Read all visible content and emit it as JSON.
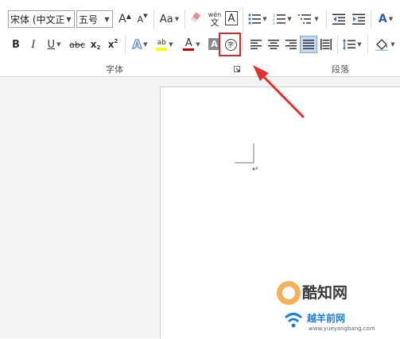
{
  "font": {
    "name": "宋体 (中文正",
    "size": "五号"
  },
  "buttons": {
    "grow_font": "A",
    "shrink_font": "A",
    "change_case": "Aa",
    "phonetic_top": "wén",
    "phonetic_bottom": "文",
    "char_border": "A",
    "bold": "B",
    "italic": "I",
    "underline": "U",
    "strikethrough": "abc",
    "subscript_base": "x",
    "subscript_sub": "2",
    "superscript_base": "x",
    "superscript_sup": "2",
    "text_effects": "A",
    "highlight": "ab",
    "font_color": "A",
    "char_shading": "A",
    "enclose_char": "字",
    "multilevel_glyph": "A"
  },
  "groups": {
    "font": "字体",
    "paragraph": "段落"
  },
  "colors": {
    "accent": "#d32b2b",
    "font_color": "#c00000",
    "highlight": "#ffff00",
    "selected": "#c5d8f0"
  },
  "watermark": {
    "brand": "酷知网",
    "site": "越羊前网",
    "url": "www.yueyangbang.com"
  }
}
